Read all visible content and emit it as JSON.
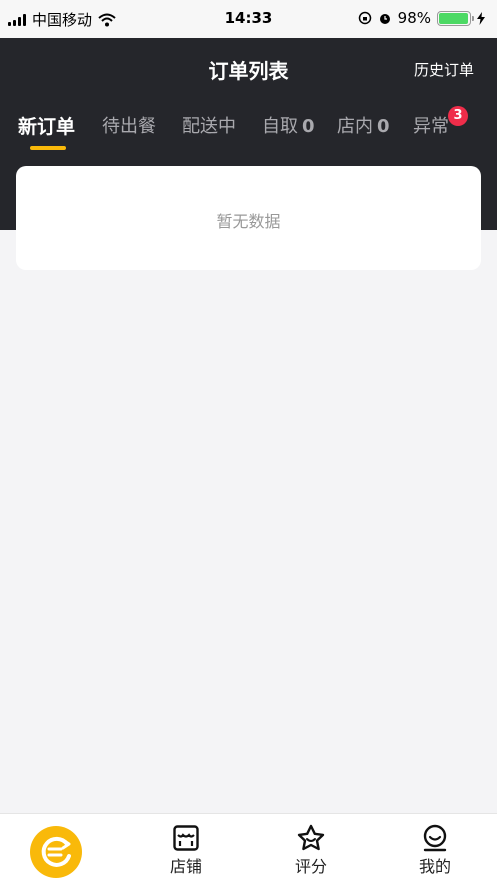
{
  "status_bar": {
    "carrier": "中国移动",
    "time": "14:33",
    "battery": "98%",
    "battery_level": 0.98
  },
  "header": {
    "title": "订单列表",
    "history_link": "历史订单"
  },
  "tabs": [
    {
      "label": "新订单",
      "count": ""
    },
    {
      "label": "待出餐",
      "count": ""
    },
    {
      "label": "配送中",
      "count": ""
    },
    {
      "label": "自取",
      "count": "0"
    },
    {
      "label": "店内",
      "count": "0"
    },
    {
      "label": "异常",
      "count": ""
    }
  ],
  "exception_badge": "3",
  "empty_state": {
    "text": "暂无数据"
  },
  "bottom_nav": {
    "items": [
      {
        "label": "",
        "icon": "home-logo-icon"
      },
      {
        "label": "店铺",
        "icon": "store-icon"
      },
      {
        "label": "评分",
        "icon": "star-icon"
      },
      {
        "label": "我的",
        "icon": "profile-icon"
      }
    ]
  },
  "colors": {
    "header_bg": "#25262b",
    "accent": "#f9b90a",
    "badge": "#ef2d4a"
  }
}
